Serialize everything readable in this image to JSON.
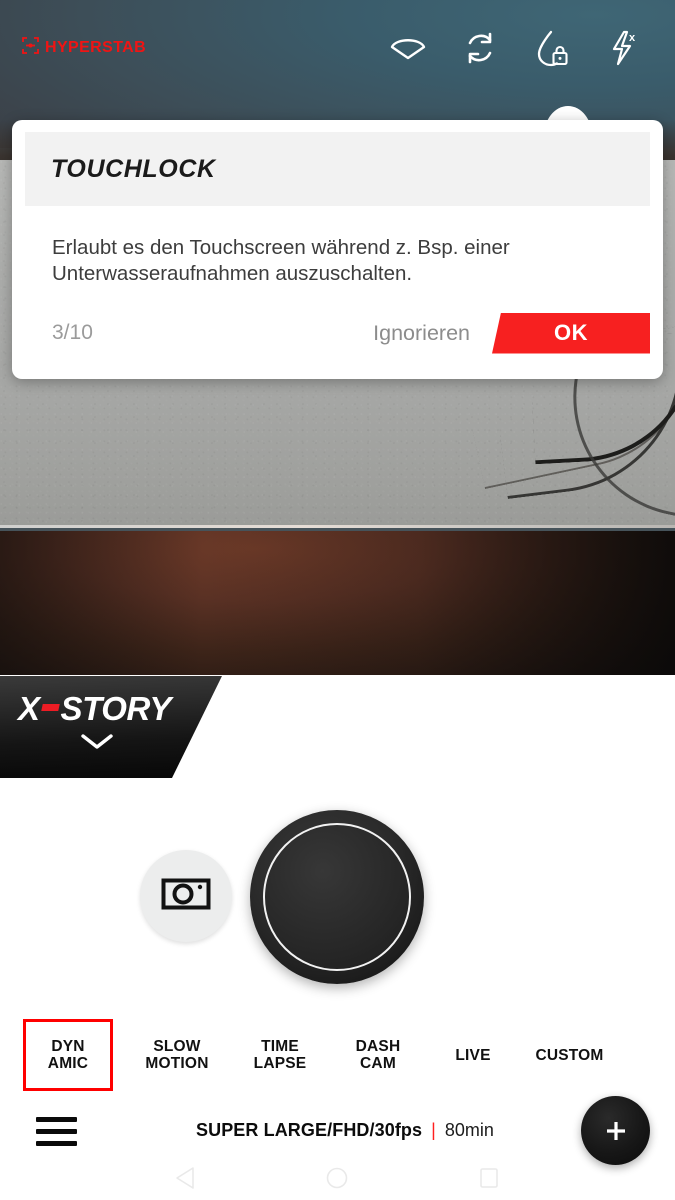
{
  "app": {
    "brand": "HYPERSTAB",
    "brand_color": "#f01414"
  },
  "topbar": {
    "icons": [
      {
        "name": "horizon-leveling-icon",
        "label": "Horizon Leveling"
      },
      {
        "name": "loop-recording-icon",
        "label": "Loop Recording"
      },
      {
        "name": "waterproof-touchlock-icon",
        "label": "Touchlock"
      },
      {
        "name": "flash-off-icon",
        "label": "Flash Off"
      }
    ]
  },
  "dialog": {
    "title": "TOUCHLOCK",
    "body": "Erlaubt es den Touchscreen während z. Bsp. einer Unterwasseraufnahmen auszuschalten.",
    "counter": "3/10",
    "ignore_label": "Ignorieren",
    "ok_label": "OK",
    "ok_color": "#f72020"
  },
  "banner": {
    "x": "X",
    "story": "STORY",
    "chevron": "chevron-down-icon"
  },
  "capture": {
    "photo_toggle": "camera-icon",
    "shutter": "shutter-button"
  },
  "modes": [
    {
      "label": "DYN\nAMIC",
      "selected": true
    },
    {
      "label": "SLOW\nMOTION",
      "selected": false
    },
    {
      "label": "TIME\nLAPSE",
      "selected": false
    },
    {
      "label": "DASH\nCAM",
      "selected": false
    },
    {
      "label": "LIVE",
      "selected": false
    },
    {
      "label": "CUSTOM",
      "selected": false
    }
  ],
  "modes_selected_color": "#ff0000",
  "bottombar": {
    "menu": "hamburger-menu-icon",
    "resolution": "SUPER LARGE/FHD/30fps",
    "separator": "|",
    "duration": "80min",
    "add": "+"
  },
  "navbar": {
    "back": "back-triangle-icon",
    "home": "home-circle-icon",
    "recents": "recents-square-icon"
  }
}
